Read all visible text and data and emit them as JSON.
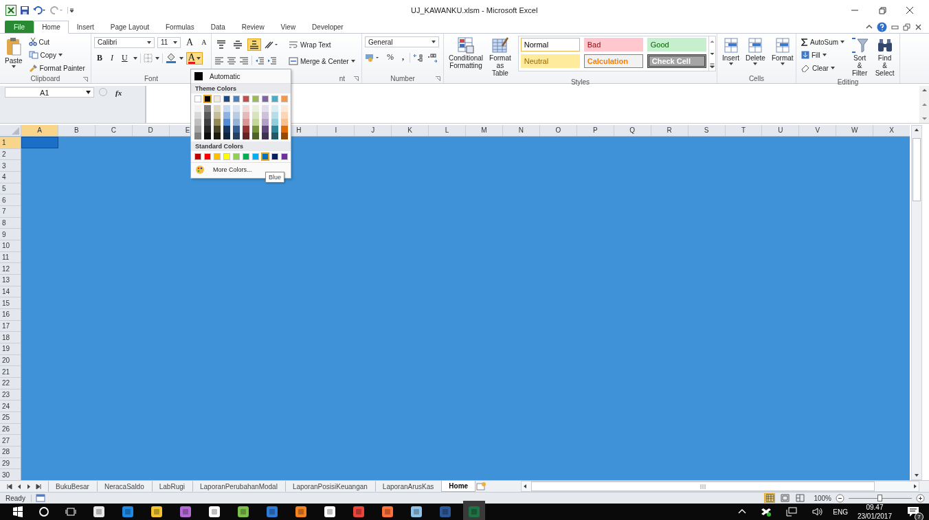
{
  "window": {
    "title": "UJ_KAWANKU.xlsm  -  Microsoft Excel"
  },
  "tabs": [
    {
      "label": "File",
      "kind": "file",
      "selected": false
    },
    {
      "label": "Home",
      "kind": "tab",
      "selected": true
    },
    {
      "label": "Insert",
      "kind": "tab",
      "selected": false
    },
    {
      "label": "Page Layout",
      "kind": "tab",
      "selected": false
    },
    {
      "label": "Formulas",
      "kind": "tab",
      "selected": false
    },
    {
      "label": "Data",
      "kind": "tab",
      "selected": false
    },
    {
      "label": "Review",
      "kind": "tab",
      "selected": false
    },
    {
      "label": "View",
      "kind": "tab",
      "selected": false
    },
    {
      "label": "Developer",
      "kind": "tab",
      "selected": false
    }
  ],
  "ribbon": {
    "clipboard": {
      "label": "Clipboard",
      "paste": "Paste",
      "cut": "Cut",
      "copy": "Copy",
      "format_painter": "Format Painter"
    },
    "font": {
      "label": "Font",
      "font_name": "Calibri",
      "font_size": "11",
      "grow": "A",
      "shrink": "A",
      "bold": "B",
      "italic": "I",
      "underline": "U",
      "font_color": {
        "glyph": "A",
        "open": true
      }
    },
    "alignment": {
      "label": "nt",
      "wrap_text": "Wrap Text",
      "merge": "Merge & Center",
      "vertical": [
        {
          "kind": "top",
          "selected": false
        },
        {
          "kind": "middle",
          "selected": false
        },
        {
          "kind": "bottom",
          "selected": true
        }
      ]
    },
    "number": {
      "label": "Number",
      "format": "General",
      "percent": "%",
      "comma": ","
    },
    "styles": {
      "label": "Styles",
      "conditional": "Conditional Formatting",
      "format_table": "Format as Table",
      "gallery": [
        {
          "label": "Normal",
          "kind": "normal"
        },
        {
          "label": "Bad",
          "kind": "bad"
        },
        {
          "label": "Good",
          "kind": "good"
        },
        {
          "label": "Neutral",
          "kind": "neutral"
        },
        {
          "label": "Calculation",
          "kind": "calculation"
        },
        {
          "label": "Check Cell",
          "kind": "check"
        }
      ]
    },
    "cells": {
      "label": "Cells",
      "buttons": [
        "Insert",
        "Delete",
        "Format"
      ]
    },
    "editing": {
      "label": "Editing",
      "autosum": "AutoSum",
      "fill": "Fill",
      "clear": "Clear",
      "sort": "Sort & Filter",
      "find": "Find & Select"
    }
  },
  "formula_bar": {
    "name_box": "A1",
    "fx": "fx"
  },
  "grid": {
    "columns": [
      {
        "label": "A",
        "selected": true
      },
      {
        "label": "B",
        "selected": false
      },
      {
        "label": "C",
        "selected": false
      },
      {
        "label": "D",
        "selected": false
      },
      {
        "label": "E",
        "selected": false
      },
      null,
      null,
      {
        "label": "H",
        "selected": false
      },
      {
        "label": "I",
        "selected": false
      },
      {
        "label": "J",
        "selected": false
      },
      {
        "label": "K",
        "selected": false
      },
      {
        "label": "L",
        "selected": false
      },
      {
        "label": "M",
        "selected": false
      },
      {
        "label": "N",
        "selected": false
      },
      {
        "label": "O",
        "selected": false
      },
      {
        "label": "P",
        "selected": false
      },
      {
        "label": "Q",
        "selected": false
      },
      {
        "label": "R",
        "selected": false
      },
      {
        "label": "S",
        "selected": false
      },
      {
        "label": "T",
        "selected": false
      },
      {
        "label": "U",
        "selected": false
      },
      {
        "label": "V",
        "selected": false
      },
      {
        "label": "W",
        "selected": false
      },
      {
        "label": "X",
        "selected": false
      }
    ],
    "rows": [
      {
        "label": "1",
        "selected": true
      },
      {
        "label": "2",
        "selected": false
      },
      {
        "label": "3",
        "selected": false
      },
      {
        "label": "4",
        "selected": false
      },
      {
        "label": "5",
        "selected": false
      },
      {
        "label": "6",
        "selected": false
      },
      {
        "label": "7",
        "selected": false
      },
      {
        "label": "8",
        "selected": false
      },
      {
        "label": "9",
        "selected": false
      },
      {
        "label": "10",
        "selected": false
      },
      {
        "label": "11",
        "selected": false
      },
      {
        "label": "12",
        "selected": false
      },
      {
        "label": "13",
        "selected": false
      },
      {
        "label": "14",
        "selected": false
      },
      {
        "label": "15",
        "selected": false
      },
      {
        "label": "16",
        "selected": false
      },
      {
        "label": "17",
        "selected": false
      },
      {
        "label": "18",
        "selected": false
      },
      {
        "label": "19",
        "selected": false
      },
      {
        "label": "20",
        "selected": false
      },
      {
        "label": "21",
        "selected": false
      },
      {
        "label": "22",
        "selected": false
      },
      {
        "label": "23",
        "selected": false
      },
      {
        "label": "24",
        "selected": false
      },
      {
        "label": "25",
        "selected": false
      },
      {
        "label": "26",
        "selected": false
      },
      {
        "label": "27",
        "selected": false
      },
      {
        "label": "28",
        "selected": false
      },
      {
        "label": "29",
        "selected": false
      },
      {
        "label": "30",
        "selected": false
      }
    ]
  },
  "color_picker": {
    "automatic": "Automatic",
    "theme_title": "Theme Colors",
    "standard_title": "Standard Colors",
    "more_colors": "More Colors...",
    "tooltip": "Blue",
    "theme_colors": [
      {
        "color": "#ffffff",
        "selected": false,
        "shades": [
          {
            "color": "#f2f2f2"
          },
          {
            "color": "#d9d9d9"
          },
          {
            "color": "#bfbfbf"
          },
          {
            "color": "#a6a6a6"
          },
          {
            "color": "#808080"
          }
        ]
      },
      {
        "color": "#000000",
        "selected": true,
        "shades": [
          {
            "color": "#7f7f7f"
          },
          {
            "color": "#595959"
          },
          {
            "color": "#404040"
          },
          {
            "color": "#262626"
          },
          {
            "color": "#0d0d0d"
          }
        ]
      },
      {
        "color": "#eeece1",
        "selected": false,
        "shades": [
          {
            "color": "#ddd9c4"
          },
          {
            "color": "#c4bd97"
          },
          {
            "color": "#948a54"
          },
          {
            "color": "#4a452a"
          },
          {
            "color": "#1d1b10"
          }
        ]
      },
      {
        "color": "#1f497d",
        "selected": false,
        "shades": [
          {
            "color": "#c6d9f0"
          },
          {
            "color": "#8db3e2"
          },
          {
            "color": "#548dd4"
          },
          {
            "color": "#17365d"
          },
          {
            "color": "#0f243e"
          }
        ]
      },
      {
        "color": "#4f81bd",
        "selected": false,
        "shades": [
          {
            "color": "#dbe5f1"
          },
          {
            "color": "#b8cce4"
          },
          {
            "color": "#95b3d7"
          },
          {
            "color": "#366092"
          },
          {
            "color": "#244061"
          }
        ]
      },
      {
        "color": "#c0504d",
        "selected": false,
        "shades": [
          {
            "color": "#f2dcdb"
          },
          {
            "color": "#e6b8b7"
          },
          {
            "color": "#da9694"
          },
          {
            "color": "#963634"
          },
          {
            "color": "#632523"
          }
        ]
      },
      {
        "color": "#9bbb59",
        "selected": false,
        "shades": [
          {
            "color": "#ebf1de"
          },
          {
            "color": "#d8e4bc"
          },
          {
            "color": "#c4d79b"
          },
          {
            "color": "#76933c"
          },
          {
            "color": "#4f6228"
          }
        ]
      },
      {
        "color": "#8064a2",
        "selected": false,
        "shades": [
          {
            "color": "#e4dfec"
          },
          {
            "color": "#ccc0da"
          },
          {
            "color": "#b1a0c7"
          },
          {
            "color": "#60497a"
          },
          {
            "color": "#403151"
          }
        ]
      },
      {
        "color": "#4bacc6",
        "selected": false,
        "shades": [
          {
            "color": "#daeef3"
          },
          {
            "color": "#b7dee8"
          },
          {
            "color": "#92cddc"
          },
          {
            "color": "#31869b"
          },
          {
            "color": "#215967"
          }
        ]
      },
      {
        "color": "#f79646",
        "selected": false,
        "shades": [
          {
            "color": "#fde9d9"
          },
          {
            "color": "#fcd5b4"
          },
          {
            "color": "#fabf8f"
          },
          {
            "color": "#e26b0a"
          },
          {
            "color": "#974706"
          }
        ]
      }
    ],
    "standard_colors": [
      {
        "color": "#c00000",
        "selected": false
      },
      {
        "color": "#ff0000",
        "selected": false
      },
      {
        "color": "#ffc000",
        "selected": false
      },
      {
        "color": "#ffff00",
        "selected": false
      },
      {
        "color": "#92d050",
        "selected": false
      },
      {
        "color": "#00b050",
        "selected": false
      },
      {
        "color": "#00b0f0",
        "selected": false
      },
      {
        "color": "#0070c0",
        "selected": true
      },
      {
        "color": "#002060",
        "selected": false
      },
      {
        "color": "#7030a0",
        "selected": false
      }
    ]
  },
  "sheet_tabs": [
    {
      "label": "BukuBesar",
      "selected": false
    },
    {
      "label": "NeracaSaldo",
      "selected": false
    },
    {
      "label": "LabRugi",
      "selected": false
    },
    {
      "label": "LaporanPerubahanModal",
      "selected": false
    },
    {
      "label": "LaporanPosisiKeuangan",
      "selected": false
    },
    {
      "label": "LaporanArusKas",
      "selected": false
    },
    {
      "label": "Home",
      "selected": true
    }
  ],
  "status_bar": {
    "status": "Ready",
    "zoom": "100%",
    "views": [
      {
        "kind": "normal",
        "selected": true
      },
      {
        "kind": "page_layout",
        "selected": false
      },
      {
        "kind": "page_break",
        "selected": false
      }
    ],
    "zoom_slider": {
      "level": 0.5
    }
  },
  "taskbar": {
    "language": "ENG",
    "time": "09.47",
    "date": "23/01/2017",
    "notifications": "7"
  }
}
